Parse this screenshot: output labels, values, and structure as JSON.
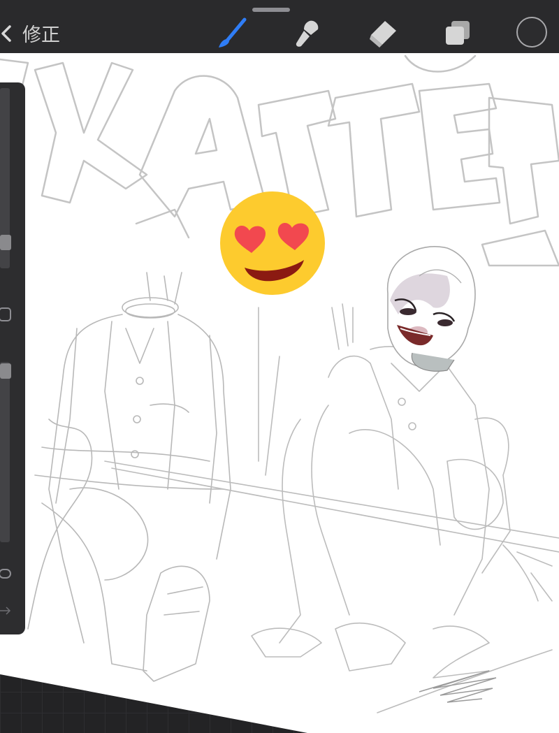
{
  "toolbar": {
    "back_label": "修正",
    "tools": [
      {
        "name": "brush",
        "icon": "brush-icon",
        "active": true,
        "color": "#2f7df6"
      },
      {
        "name": "smudge",
        "icon": "smudge-icon",
        "active": false
      },
      {
        "name": "eraser",
        "icon": "eraser-icon",
        "active": false
      },
      {
        "name": "layers",
        "icon": "layers-icon",
        "active": false
      }
    ],
    "current_color": "#2c2c2e"
  },
  "sidebar": {
    "brush_size": 0.85,
    "opacity": 1.0
  },
  "canvas": {
    "emoji": "heart-eyes-emoji",
    "emoji_colors": {
      "face": "#fdcb2e",
      "hearts": "#f2484f",
      "mouth": "#8b1a12"
    },
    "sketch_color": "#bdbdbd"
  }
}
